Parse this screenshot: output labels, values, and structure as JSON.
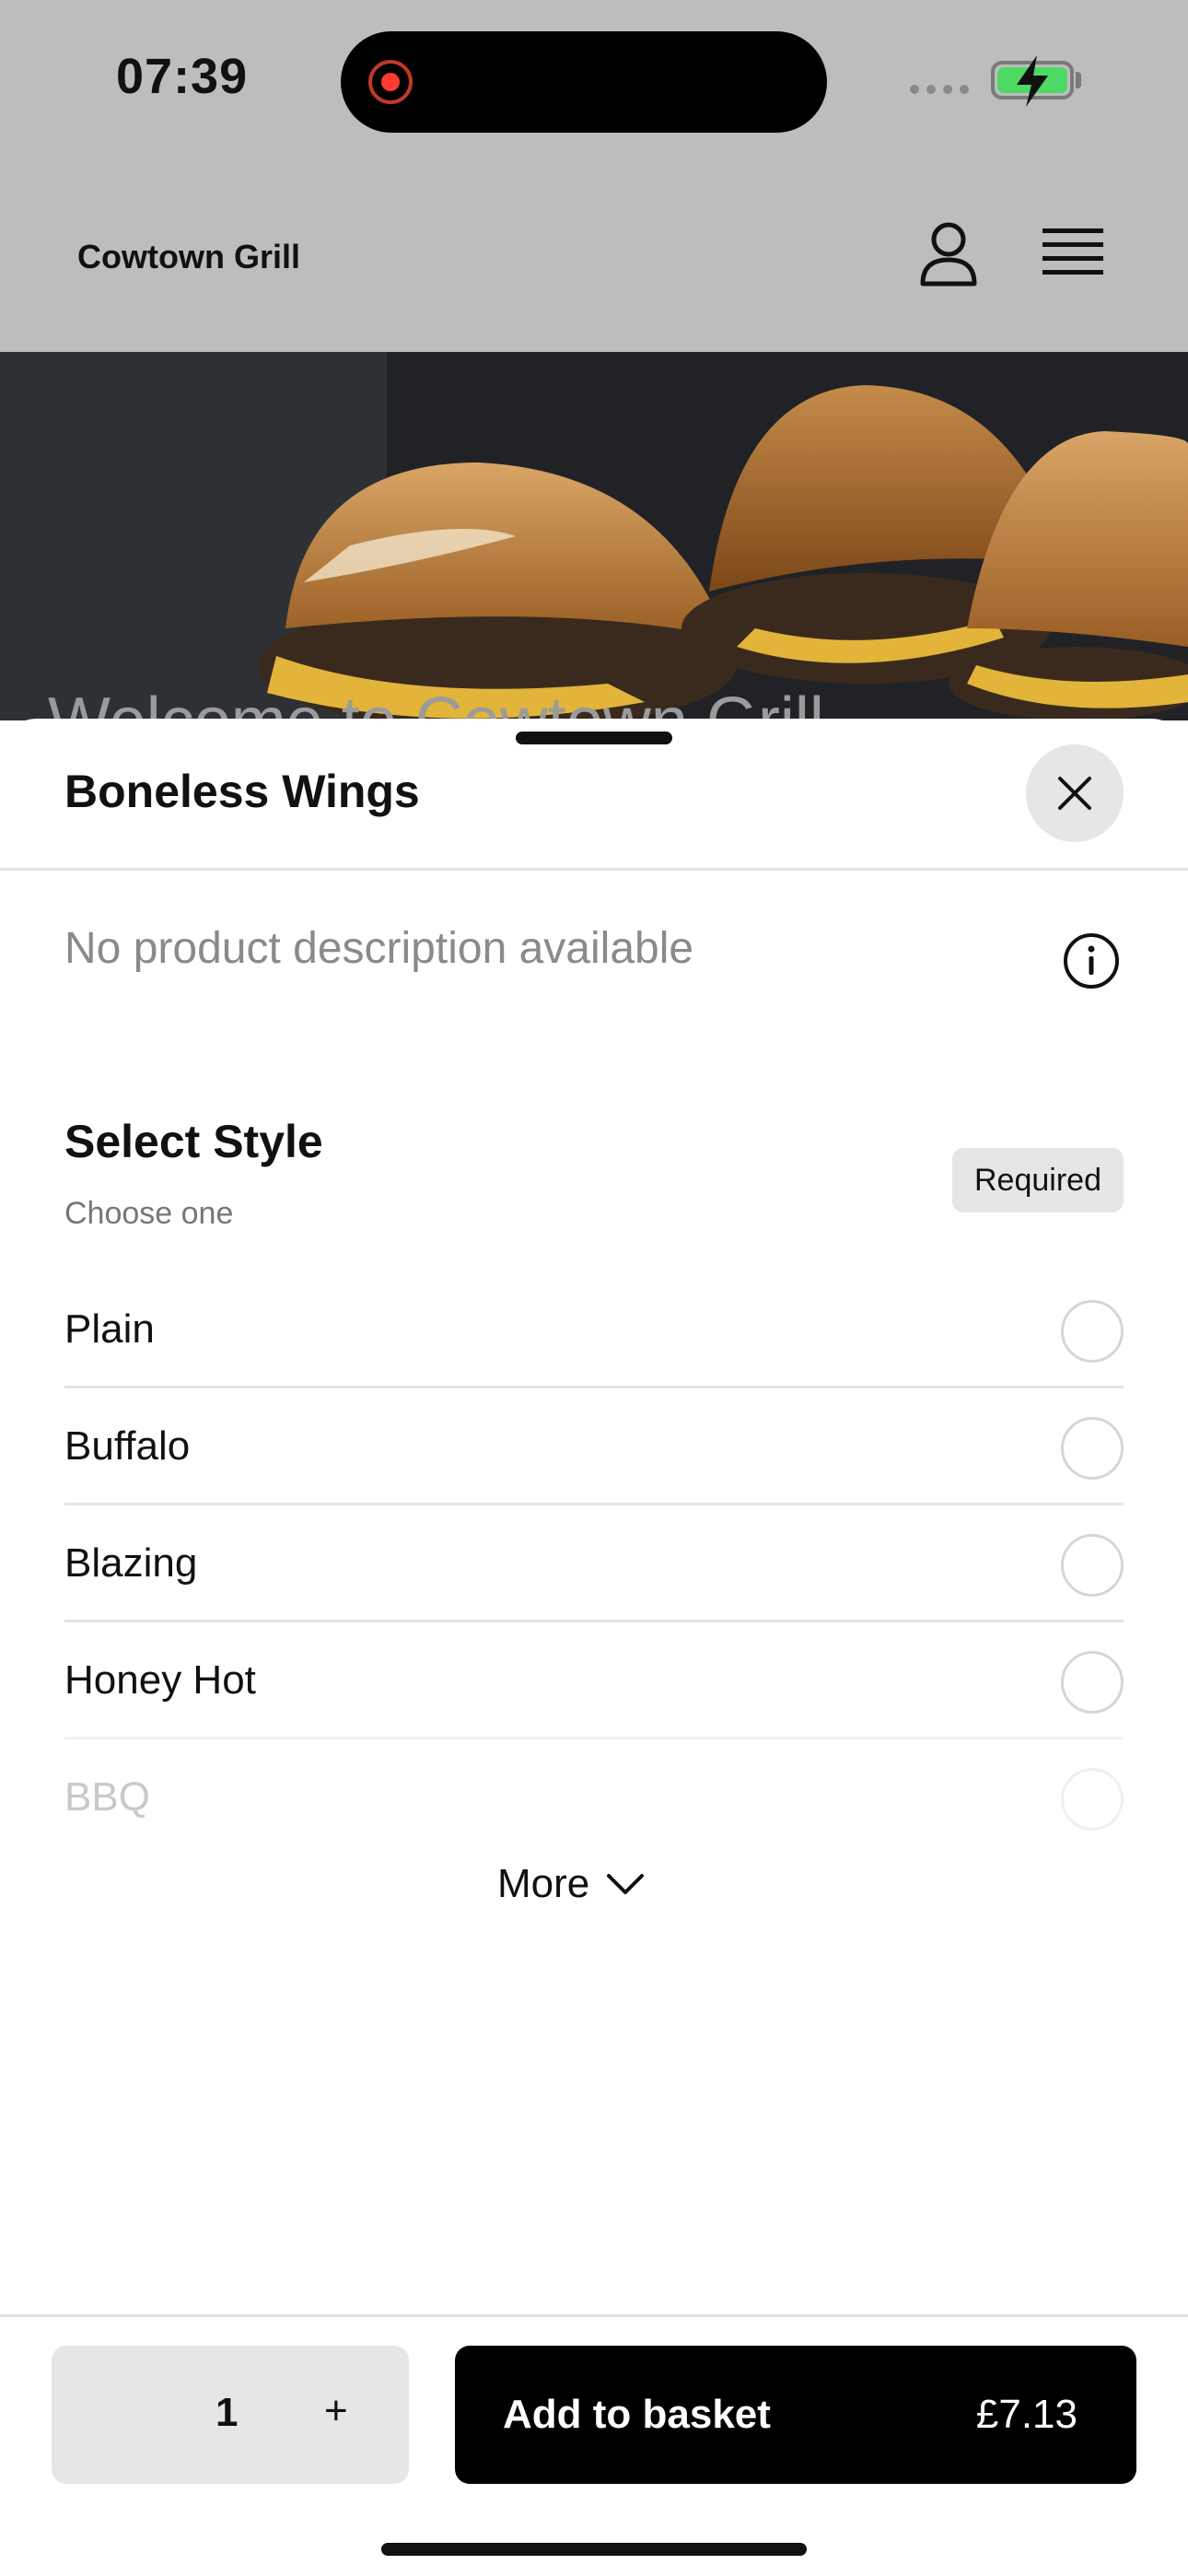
{
  "status_bar": {
    "time": "07:39"
  },
  "header": {
    "brand": "Cowtown Grill"
  },
  "hero": {
    "title": "Welcome to Cowtown Grill"
  },
  "sheet": {
    "title": "Boneless Wings",
    "description": "No product description available",
    "section": {
      "title": "Select Style",
      "subtitle": "Choose one",
      "badge": "Required",
      "options": [
        {
          "label": "Plain"
        },
        {
          "label": "Buffalo"
        },
        {
          "label": "Blazing"
        },
        {
          "label": "Honey Hot"
        },
        {
          "label": "BBQ"
        }
      ],
      "more_label": "More"
    }
  },
  "footer": {
    "quantity": "1",
    "plus_label": "+",
    "add_label": "Add to basket",
    "price": "£7.13"
  },
  "colors": {
    "accent": "#000000",
    "dim_overlay": "#bdbdbd",
    "badge_bg": "#e6e6e6",
    "record_red": "#ff3b30",
    "battery_green": "#4cd964"
  }
}
